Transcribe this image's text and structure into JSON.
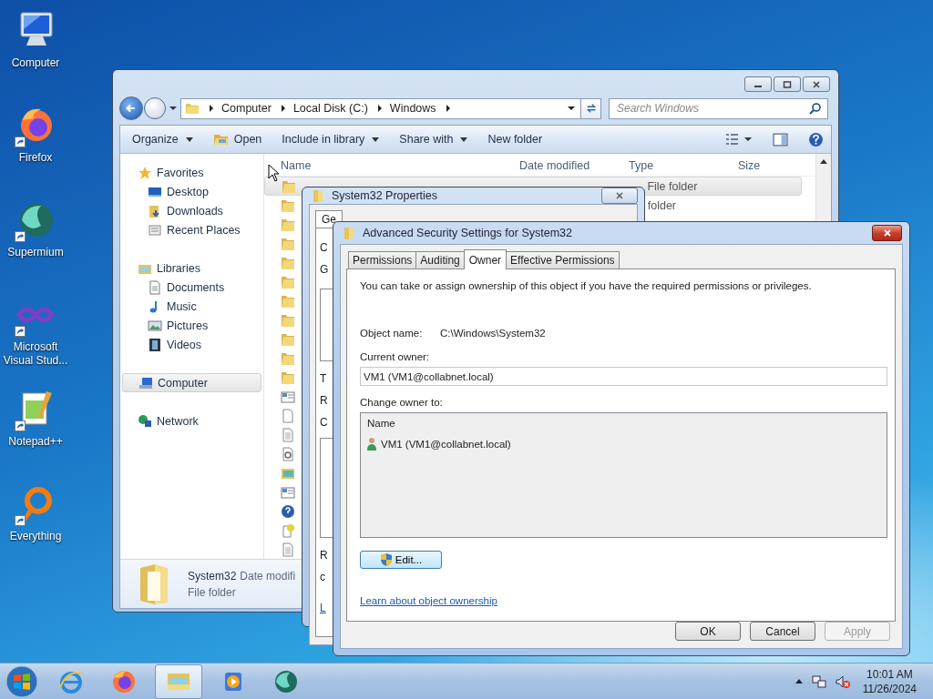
{
  "desktop_icons": [
    {
      "label": "Computer",
      "kind": "computer",
      "shortcut": false
    },
    {
      "label": "Firefox",
      "kind": "firefox",
      "shortcut": true
    },
    {
      "label": "Supermium",
      "kind": "supermium",
      "shortcut": true
    },
    {
      "label": "Microsoft Visual Stud...",
      "kind": "visualstudio",
      "shortcut": true
    },
    {
      "label": "Notepad++",
      "kind": "notepad",
      "shortcut": true
    },
    {
      "label": "Everything",
      "kind": "everything",
      "shortcut": true
    }
  ],
  "explorer": {
    "address": [
      "Computer",
      "Local Disk (C:)",
      "Windows"
    ],
    "search": {
      "placeholder": "Search Windows"
    },
    "toolbar": [
      {
        "label": "Organize",
        "kind": "menu"
      },
      {
        "label": "Open",
        "kind": "open"
      },
      {
        "label": "Include in library",
        "kind": "menu"
      },
      {
        "label": "Share with",
        "kind": "menu"
      },
      {
        "label": "New folder",
        "kind": "plain"
      }
    ],
    "nav": [
      {
        "label": "Favorites",
        "kind": "star",
        "selected": false,
        "children": [
          {
            "label": "Desktop",
            "kind": "desktop",
            "selected": false
          },
          {
            "label": "Downloads",
            "kind": "downloads",
            "selected": false
          },
          {
            "label": "Recent Places",
            "kind": "recent",
            "selected": false
          }
        ]
      },
      {
        "label": "Libraries",
        "kind": "libraries",
        "selected": false,
        "children": [
          {
            "label": "Documents",
            "kind": "documents",
            "selected": false
          },
          {
            "label": "Music",
            "kind": "music",
            "selected": false
          },
          {
            "label": "Pictures",
            "kind": "pictures",
            "selected": false
          },
          {
            "label": "Videos",
            "kind": "videos",
            "selected": false
          }
        ]
      },
      {
        "label": "Computer",
        "kind": "computer",
        "selected": true
      },
      {
        "label": "Network",
        "kind": "network",
        "selected": false
      }
    ],
    "columns": [
      "Name",
      "Date modified",
      "Type",
      "Size"
    ],
    "rows": [
      {
        "kind": "folder",
        "selected": true,
        "type": "File folder"
      },
      {
        "kind": "folder",
        "selected": false,
        "type": "folder"
      },
      {
        "kind": "folder",
        "selected": false
      },
      {
        "kind": "folder",
        "selected": false
      },
      {
        "kind": "folder",
        "selected": false
      },
      {
        "kind": "folder",
        "selected": false
      },
      {
        "kind": "folder",
        "selected": false
      },
      {
        "kind": "folder",
        "selected": false
      },
      {
        "kind": "folder",
        "selected": false
      },
      {
        "kind": "folder",
        "selected": false
      },
      {
        "kind": "folder",
        "selected": false
      },
      {
        "kind": "window",
        "selected": false
      },
      {
        "kind": "blank",
        "selected": false
      },
      {
        "kind": "text",
        "selected": false
      },
      {
        "kind": "settings",
        "selected": false
      },
      {
        "kind": "picture",
        "selected": false
      },
      {
        "kind": "window",
        "selected": false
      },
      {
        "kind": "help",
        "selected": false
      },
      {
        "kind": "helpdoc",
        "selected": false
      },
      {
        "kind": "text",
        "selected": false
      }
    ],
    "details": {
      "name": "System32",
      "info": "Date modifi",
      "type": "File folder"
    }
  },
  "properties": {
    "title": "System32 Properties",
    "tab": "Ge",
    "fragments": [
      {
        "text": "C",
        "kind": "label"
      },
      {
        "text": "G",
        "kind": "label"
      },
      {
        "kind": "box"
      },
      {
        "text": "T",
        "kind": "label"
      },
      {
        "text": "R",
        "kind": "label"
      },
      {
        "text": "C",
        "kind": "label"
      },
      {
        "kind": "box"
      },
      {
        "text": "R",
        "kind": "label"
      },
      {
        "text": "c",
        "kind": "label"
      },
      {
        "text": "L",
        "kind": "link"
      }
    ]
  },
  "advanced": {
    "title": "Advanced Security Settings for System32",
    "tabs": [
      {
        "label": "Permissions",
        "selected": false
      },
      {
        "label": "Auditing",
        "selected": false
      },
      {
        "label": "Owner",
        "selected": true
      },
      {
        "label": "Effective Permissions",
        "selected": false
      }
    ],
    "intro": "You can take or assign ownership of this object if you have the required permissions or privileges.",
    "object_name": {
      "label": "Object name:",
      "value": "C:\\Windows\\System32"
    },
    "current_owner": {
      "label": "Current owner:",
      "value": "VM1 (VM1@collabnet.local)"
    },
    "change_owner": {
      "label": "Change owner to:",
      "column": "Name",
      "items": [
        {
          "label": "VM1 (VM1@collabnet.local)",
          "selected": false
        }
      ]
    },
    "edit_button": "Edit...",
    "link": "Learn about object ownership",
    "buttons": [
      {
        "label": "OK",
        "disabled": false
      },
      {
        "label": "Cancel",
        "disabled": false
      },
      {
        "label": "Apply",
        "disabled": true
      }
    ]
  },
  "taskbar": {
    "apps": [
      {
        "kind": "ie",
        "active": false
      },
      {
        "kind": "firefox",
        "active": false
      },
      {
        "kind": "explorer",
        "active": true
      },
      {
        "kind": "media",
        "active": false
      },
      {
        "kind": "supermium",
        "active": false
      }
    ],
    "clock": {
      "time": "10:01 AM",
      "date": "11/26/2024"
    }
  }
}
